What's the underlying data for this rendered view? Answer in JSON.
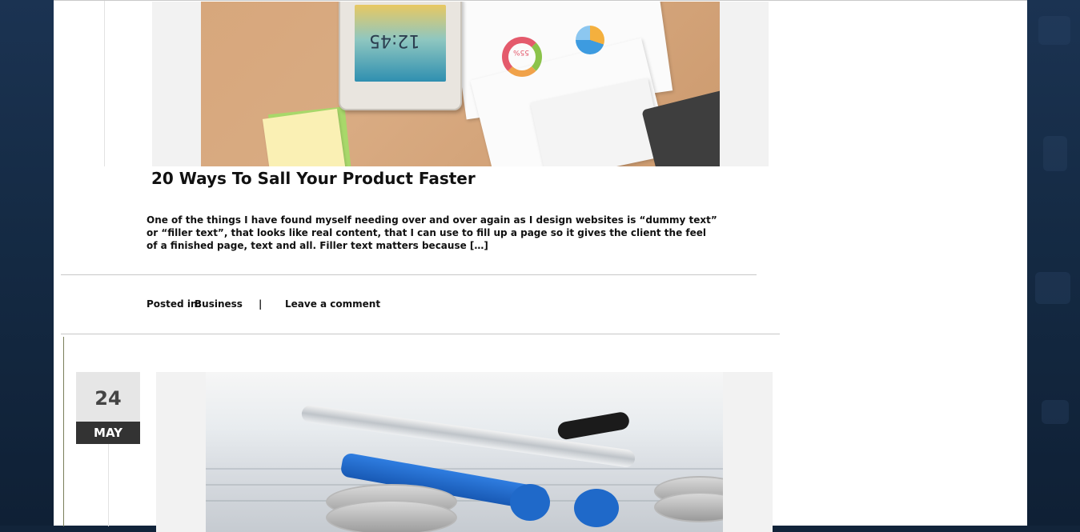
{
  "post1": {
    "title": "20 Ways To Sall Your Product Faster",
    "excerpt": "One of the things I have found myself needing over and over again as I design websites is “dummy text” or “filler text”, that looks like real content, that I can use to fill up a page so it gives the client the feel of a finished page, text and all. Filler text matters because […]",
    "image_alt": "Smartphone with business charts on wooden desk",
    "phone_clock": "12:45",
    "chart_percent": "55%",
    "meta": {
      "posted_in_label": "Posted in:",
      "category": "Business",
      "separator": "|",
      "comment_link": "Leave a comment"
    }
  },
  "post2": {
    "date": {
      "day": "24",
      "month": "MAY"
    },
    "image_alt": "Pens and coins on financial documents"
  },
  "colors": {
    "page_bg": "#ffffff",
    "outer_bg": "#12243a",
    "date_day_bg": "#e6e6e6",
    "date_month_bg": "#333333",
    "text": "#111111"
  }
}
